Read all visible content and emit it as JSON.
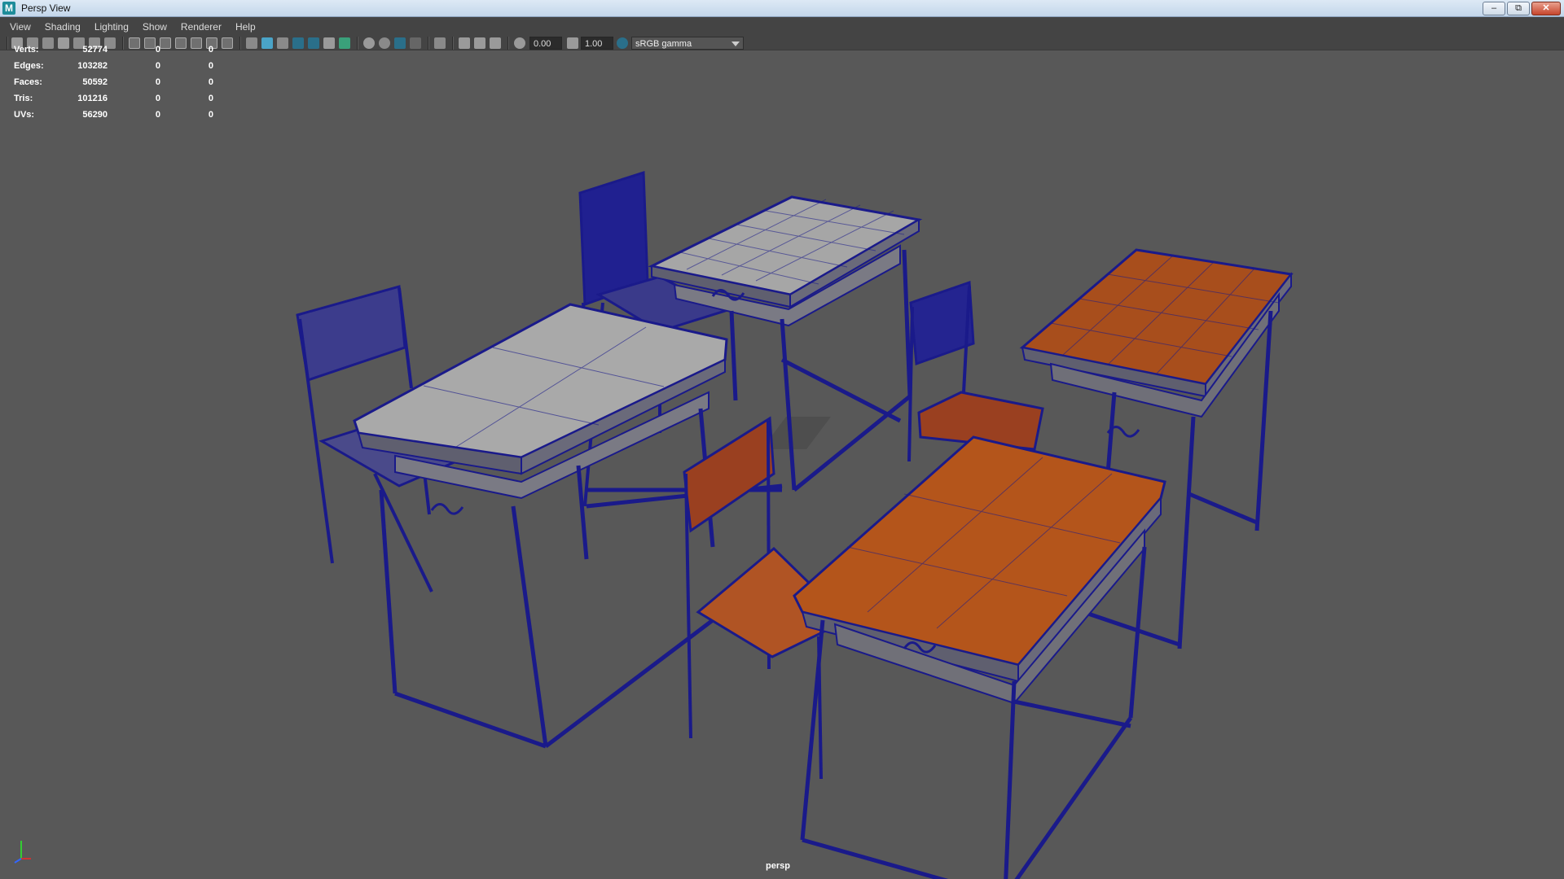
{
  "window": {
    "title": "Persp View",
    "app_icon": "M"
  },
  "window_buttons": {
    "minimize": "–",
    "maximize": "⧉",
    "close": "✕"
  },
  "menus": [
    "View",
    "Shading",
    "Lighting",
    "Show",
    "Renderer",
    "Help"
  ],
  "toolbar": {
    "exposure_value": "0.00",
    "gamma_value": "1.00",
    "color_space": "sRGB gamma",
    "accent_active": "#2a6f8a"
  },
  "hud": {
    "rows": [
      {
        "label": "Verts:",
        "v1": "52774",
        "v2": "0",
        "v3": "0"
      },
      {
        "label": "Edges:",
        "v1": "103282",
        "v2": "0",
        "v3": "0"
      },
      {
        "label": "Faces:",
        "v1": "50592",
        "v2": "0",
        "v3": "0"
      },
      {
        "label": "Tris:",
        "v1": "101216",
        "v2": "0",
        "v3": "0"
      },
      {
        "label": "UVs:",
        "v1": "56290",
        "v2": "0",
        "v3": "0"
      }
    ]
  },
  "viewport": {
    "camera": "persp",
    "background": "#585858",
    "wire_color": "#1a1a8a",
    "wood_color": "#b5541a",
    "grey_color": "#a9a9a9"
  }
}
